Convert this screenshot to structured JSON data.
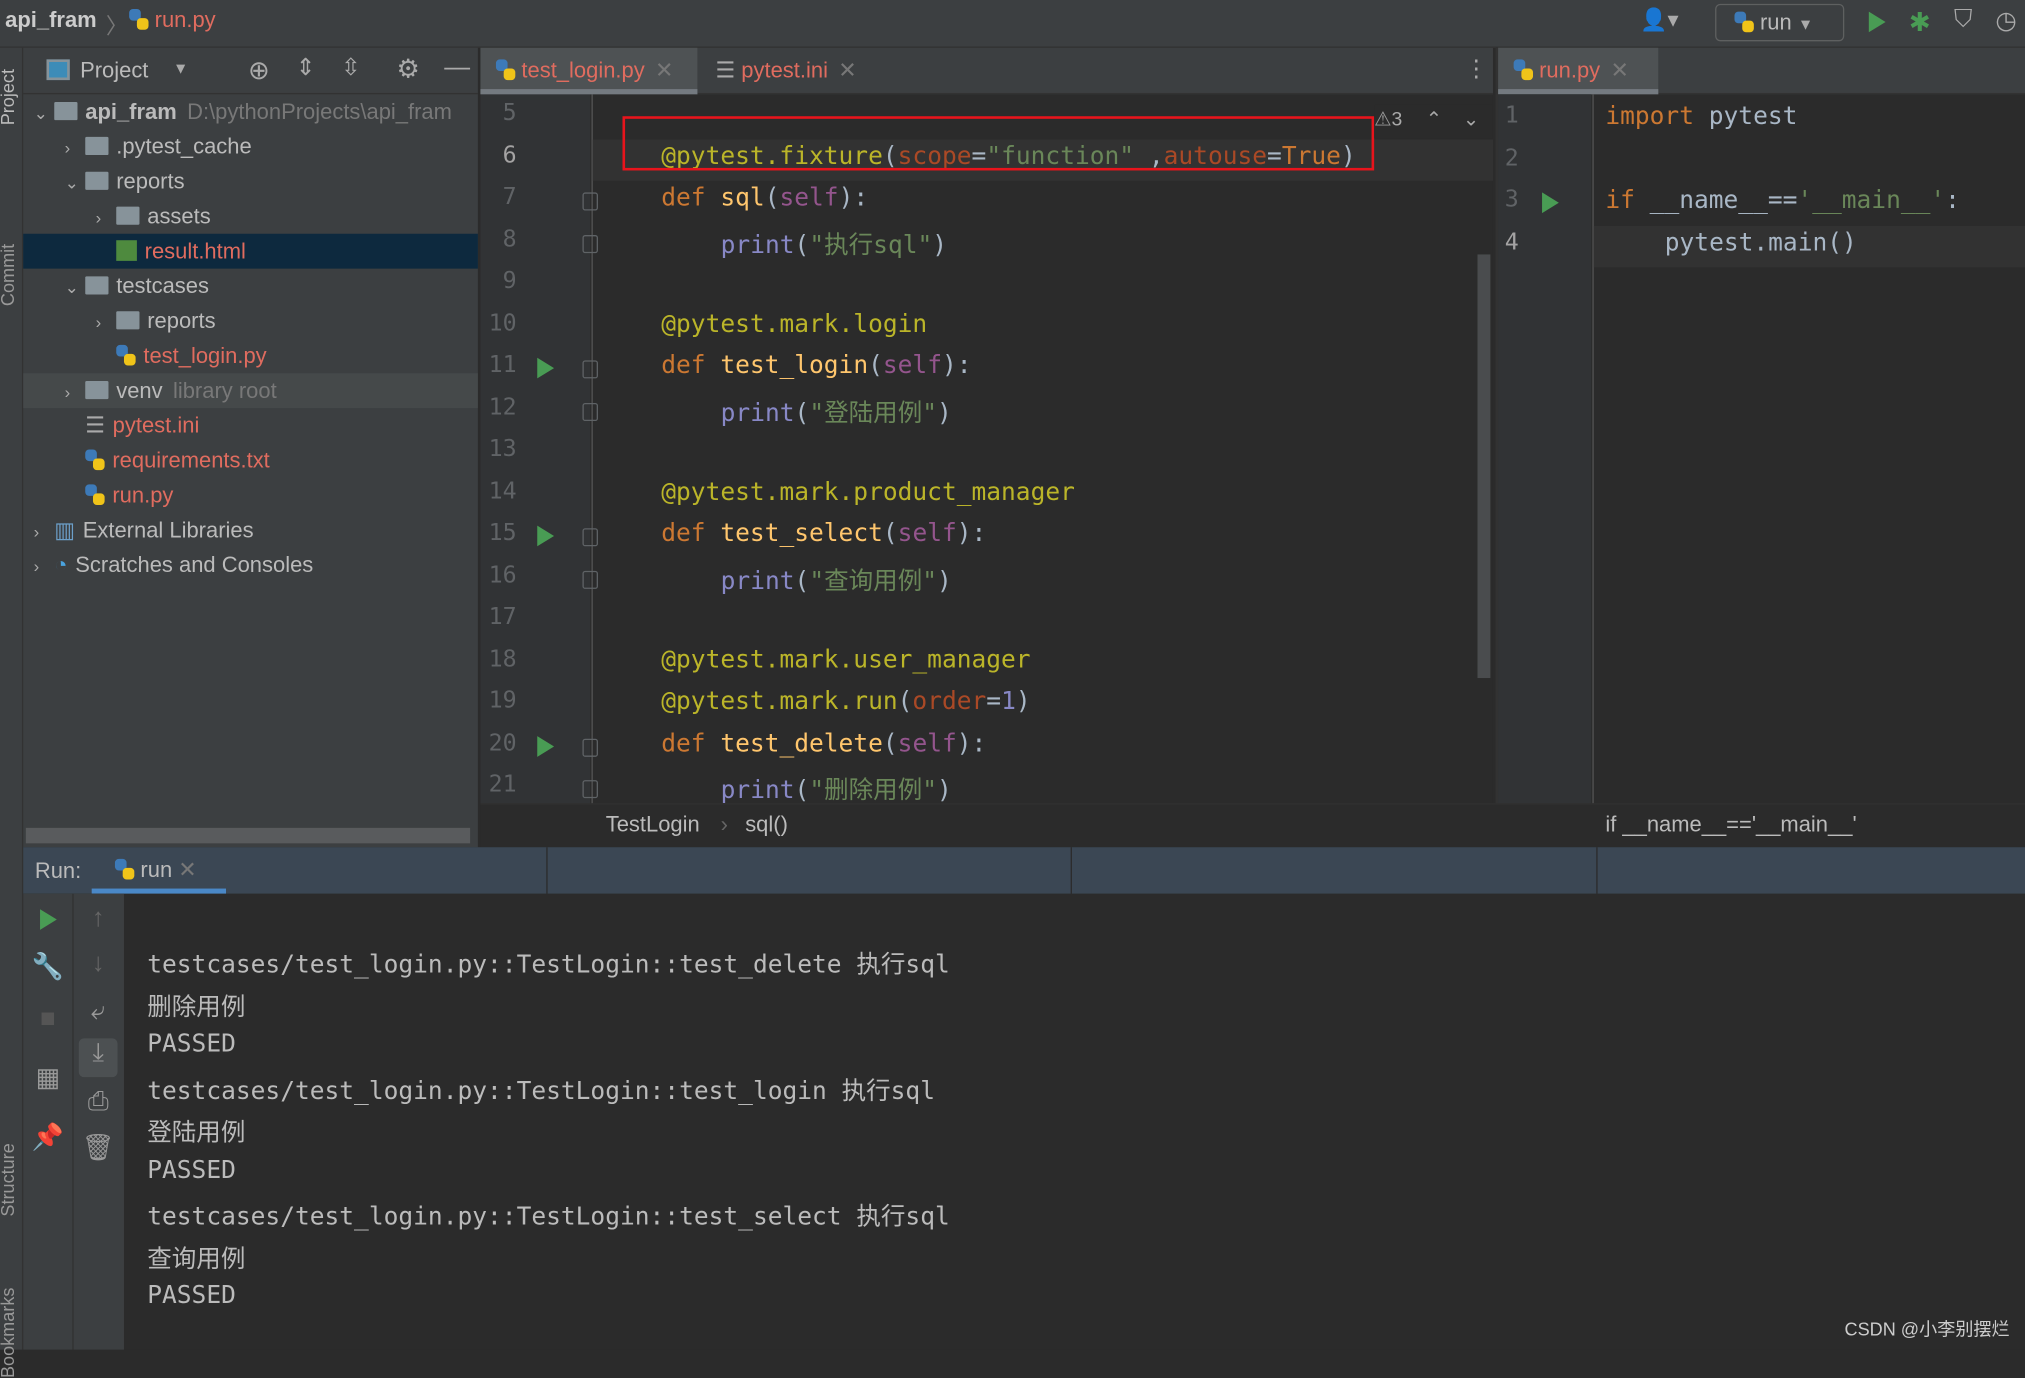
{
  "titlebar": {
    "project": "api_fram",
    "file": "run.py",
    "run_config": "run"
  },
  "sidebar_stripe": {
    "top": [
      "Project",
      "Commit"
    ],
    "bottom": [
      "Structure",
      "Bookmarks"
    ]
  },
  "project_panel": {
    "title": "Project",
    "tree": [
      {
        "label": "api_fram",
        "hint": "D:\\pythonProjects\\api_fram",
        "level": 0,
        "type": "folder",
        "open": true,
        "bold": true
      },
      {
        "label": ".pytest_cache",
        "level": 1,
        "type": "folder",
        "open": false
      },
      {
        "label": "reports",
        "level": 1,
        "type": "folder",
        "open": true
      },
      {
        "label": "assets",
        "level": 2,
        "type": "folder",
        "open": false
      },
      {
        "label": "result.html",
        "level": 2,
        "type": "html",
        "selected": true,
        "red": true
      },
      {
        "label": "testcases",
        "level": 1,
        "type": "folder",
        "open": true
      },
      {
        "label": "reports",
        "level": 2,
        "type": "folder",
        "open": false
      },
      {
        "label": "test_login.py",
        "level": 2,
        "type": "py",
        "red": true
      },
      {
        "label": "venv",
        "hint": "library root",
        "level": 1,
        "type": "folder",
        "open": false,
        "highlight": true
      },
      {
        "label": "pytest.ini",
        "level": 1,
        "type": "ini",
        "red": true
      },
      {
        "label": "requirements.txt",
        "level": 1,
        "type": "txt",
        "red": true
      },
      {
        "label": "run.py",
        "level": 1,
        "type": "py",
        "red": true
      },
      {
        "label": "External Libraries",
        "level": 0,
        "type": "lib",
        "open": false
      },
      {
        "label": "Scratches and Consoles",
        "level": 0,
        "type": "scratch",
        "open": false
      }
    ]
  },
  "editor_left": {
    "tabs": [
      {
        "label": "test_login.py",
        "active": true
      },
      {
        "label": "pytest.ini",
        "active": false
      }
    ],
    "warning_count": "3",
    "lines": [
      {
        "n": "5",
        "tokens": []
      },
      {
        "n": "6",
        "indent": 0,
        "current": true,
        "tokens": [
          [
            "@pytest.fixture",
            "d"
          ],
          [
            "(",
            "n"
          ],
          [
            "scope",
            "pa"
          ],
          [
            "=",
            "n"
          ],
          [
            "\"function\"",
            "s"
          ],
          [
            " ,",
            "n"
          ],
          [
            "autouse",
            "pa"
          ],
          [
            "=",
            "n"
          ],
          [
            "True",
            "k"
          ],
          [
            ")",
            "n"
          ]
        ]
      },
      {
        "n": "7",
        "indent": 0,
        "tokens": [
          [
            "def ",
            "k"
          ],
          [
            "sql",
            "f"
          ],
          [
            "(",
            "n"
          ],
          [
            "self",
            "p"
          ],
          [
            "):",
            "n"
          ]
        ]
      },
      {
        "n": "8",
        "indent": 1,
        "tokens": [
          [
            "print",
            "b"
          ],
          [
            "(",
            "n"
          ],
          [
            "\"执行sql\"",
            "s"
          ],
          [
            ")",
            "n"
          ]
        ]
      },
      {
        "n": "9",
        "tokens": []
      },
      {
        "n": "10",
        "indent": 0,
        "tokens": [
          [
            "@pytest.mark.login",
            "d"
          ]
        ]
      },
      {
        "n": "11",
        "indent": 0,
        "run": true,
        "tokens": [
          [
            "def ",
            "k"
          ],
          [
            "test_login",
            "f"
          ],
          [
            "(",
            "n"
          ],
          [
            "self",
            "p"
          ],
          [
            "):",
            "n"
          ]
        ]
      },
      {
        "n": "12",
        "indent": 1,
        "tokens": [
          [
            "print",
            "b"
          ],
          [
            "(",
            "n"
          ],
          [
            "\"登陆用例\"",
            "s"
          ],
          [
            ")",
            "n"
          ]
        ]
      },
      {
        "n": "13",
        "tokens": []
      },
      {
        "n": "14",
        "indent": 0,
        "tokens": [
          [
            "@pytest.mark.product_manager",
            "d"
          ]
        ]
      },
      {
        "n": "15",
        "indent": 0,
        "run": true,
        "tokens": [
          [
            "def ",
            "k"
          ],
          [
            "test_select",
            "f"
          ],
          [
            "(",
            "n"
          ],
          [
            "self",
            "p"
          ],
          [
            "):",
            "n"
          ]
        ]
      },
      {
        "n": "16",
        "indent": 1,
        "tokens": [
          [
            "print",
            "b"
          ],
          [
            "(",
            "n"
          ],
          [
            "\"查询用例\"",
            "s"
          ],
          [
            ")",
            "n"
          ]
        ]
      },
      {
        "n": "17",
        "tokens": []
      },
      {
        "n": "18",
        "indent": 0,
        "tokens": [
          [
            "@pytest.mark.user_manager",
            "d"
          ]
        ]
      },
      {
        "n": "19",
        "indent": 0,
        "tokens": [
          [
            "@pytest.mark.run",
            "d"
          ],
          [
            "(",
            "n"
          ],
          [
            "order",
            "pa"
          ],
          [
            "=",
            "n"
          ],
          [
            "1",
            "b"
          ],
          [
            ")",
            "n"
          ]
        ]
      },
      {
        "n": "20",
        "indent": 0,
        "run": true,
        "tokens": [
          [
            "def ",
            "k"
          ],
          [
            "test_delete",
            "f"
          ],
          [
            "(",
            "n"
          ],
          [
            "self",
            "p"
          ],
          [
            "):",
            "n"
          ]
        ]
      },
      {
        "n": "21",
        "indent": 1,
        "tokens": [
          [
            "print",
            "b"
          ],
          [
            "(",
            "n"
          ],
          [
            "\"删除用例\"",
            "s"
          ],
          [
            ")",
            "n"
          ]
        ]
      }
    ],
    "breadcrumb": [
      "TestLogin",
      "sql()"
    ]
  },
  "editor_right": {
    "tabs": [
      {
        "label": "run.py",
        "active": true
      }
    ],
    "lines": [
      {
        "n": "1",
        "indent": 0,
        "tokens": [
          [
            "import ",
            "k"
          ],
          [
            "pytest",
            "n"
          ]
        ]
      },
      {
        "n": "2",
        "tokens": []
      },
      {
        "n": "3",
        "indent": 0,
        "run": true,
        "tokens": [
          [
            "if ",
            "k"
          ],
          [
            "__name__",
            "n"
          ],
          [
            "==",
            "n"
          ],
          [
            "'__main__'",
            "s"
          ],
          [
            ":",
            "n"
          ]
        ]
      },
      {
        "n": "4",
        "indent": 1,
        "current": true,
        "tokens": [
          [
            "pytest.main()",
            "n"
          ]
        ]
      }
    ],
    "breadcrumb": "if __name__=='__main__'"
  },
  "run_panel": {
    "label": "Run:",
    "tab": "run",
    "output": [
      "testcases/test_login.py::TestLogin::test_delete 执行sql",
      "删除用例",
      "PASSED",
      "testcases/test_login.py::TestLogin::test_login 执行sql",
      "登陆用例",
      "PASSED",
      "testcases/test_login.py::TestLogin::test_select 执行sql",
      "查询用例",
      "PASSED"
    ]
  },
  "watermark": "CSDN @小李别摆烂",
  "colors": {
    "highlight_box": "#e8141c",
    "run_green": "#499c54",
    "file_modified": "#e06c5f"
  }
}
